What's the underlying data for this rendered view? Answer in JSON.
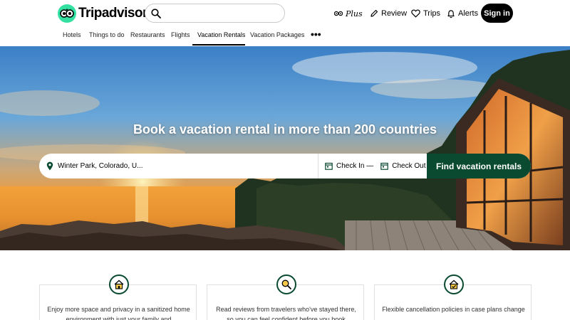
{
  "brand": {
    "name": "Tripadvisor",
    "color": "#34e0a1"
  },
  "search": {
    "placeholder": "",
    "value": ""
  },
  "header_actions": [
    {
      "label": "Plus",
      "icon": "plus-logo-icon"
    },
    {
      "label": "Review",
      "icon": "pencil-icon"
    },
    {
      "label": "Trips",
      "icon": "heart-icon"
    },
    {
      "label": "Alerts",
      "icon": "bell-icon"
    }
  ],
  "signin": {
    "label": "Sign in"
  },
  "subnav": {
    "tabs": [
      "Hotels",
      "Things to do",
      "Restaurants",
      "Flights",
      "Vacation Rentals",
      "Vacation Packages"
    ],
    "active": "Vacation Rentals",
    "more": "•••"
  },
  "hero": {
    "title": "Book a vacation rental in more than 200 countries",
    "location_value": "Winter Park, Colorado, U...",
    "check_in": "Check In —",
    "check_out": "Check Out",
    "find_button": "Find vacation rentals"
  },
  "features": [
    {
      "icon": "house-icon",
      "text": "Enjoy more space and privacy in a sanitized home environment with just your family and"
    },
    {
      "icon": "magnifier-icon",
      "text": "Read reviews from travelers who've stayed there, so you can feel confident before you book"
    },
    {
      "icon": "house-check-icon",
      "text": "Flexible cancellation policies in case plans change"
    }
  ],
  "colors": {
    "accent": "#0a4a30",
    "dark": "#000000"
  }
}
